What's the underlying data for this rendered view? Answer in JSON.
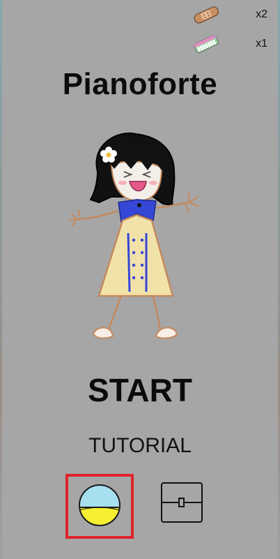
{
  "title": "Pianoforte",
  "inventory": {
    "items": [
      {
        "icon": "bandage-item-icon",
        "count_label": "x2"
      },
      {
        "icon": "toy-piano-item-icon",
        "count_label": "x1"
      }
    ]
  },
  "menu": {
    "start_label": "START",
    "tutorial_label": "TUTORIAL"
  },
  "bottom_buttons": [
    {
      "icon": "ball-icon",
      "selected": true,
      "colors": {
        "top": "#a6dff0",
        "bottom": "#f7f032",
        "highlight": "#e0242c"
      }
    },
    {
      "icon": "chest-icon",
      "selected": false
    }
  ],
  "colors": {
    "background": "#a6a6a6",
    "selection_border": "#e0242c"
  }
}
